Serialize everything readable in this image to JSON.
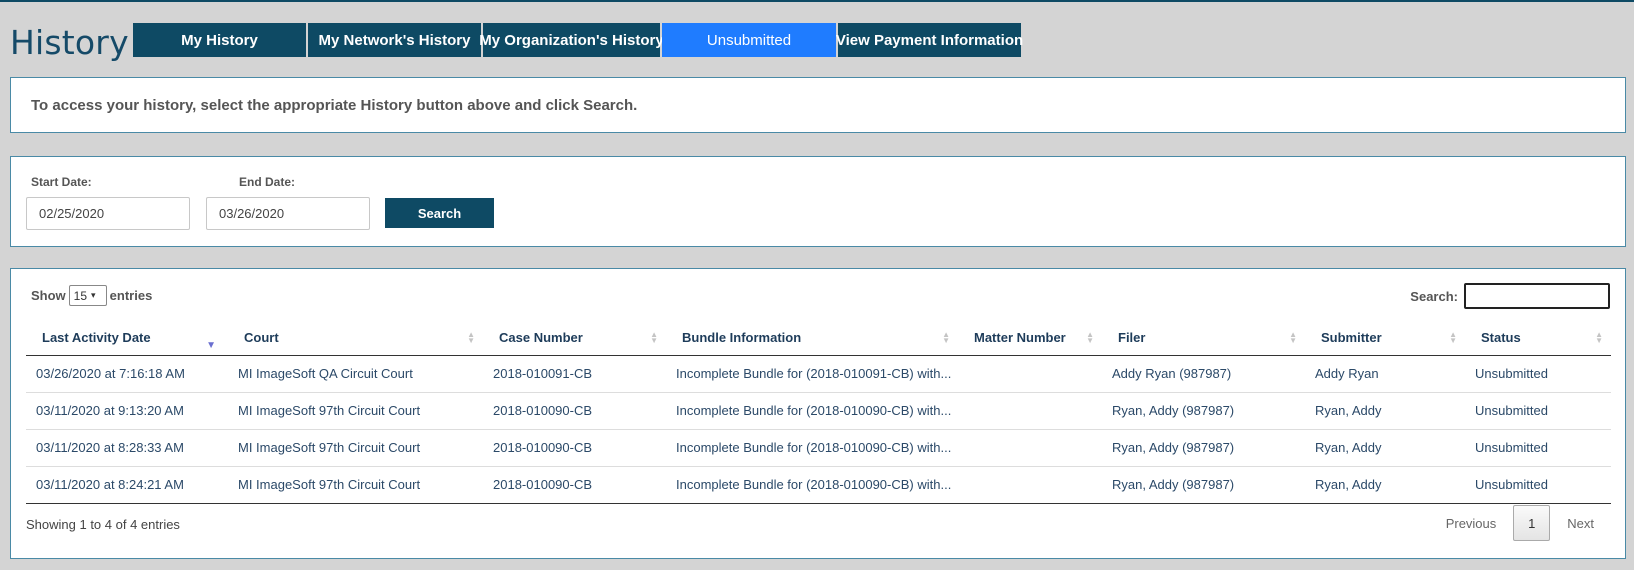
{
  "page": {
    "title": "History"
  },
  "tabs": [
    {
      "label": "My History",
      "active": false
    },
    {
      "label": "My Network's History",
      "active": false
    },
    {
      "label": "My Organization's History",
      "active": false
    },
    {
      "label": "Unsubmitted",
      "active": true
    },
    {
      "label": "View Payment Information",
      "active": false
    }
  ],
  "info": {
    "text": "To access your history, select the appropriate History button above and click Search."
  },
  "filters": {
    "start_label": "Start Date:",
    "start_value": "02/25/2020",
    "end_label": "End Date:",
    "end_value": "03/26/2020",
    "search_label": "Search"
  },
  "table": {
    "show_label": "Show",
    "entries_value": "15",
    "entries_label": "entries",
    "search_label": "Search:",
    "columns": [
      "Last Activity Date",
      "Court",
      "Case Number",
      "Bundle Information",
      "Matter Number",
      "Filer",
      "Submitter",
      "Status"
    ],
    "rows": [
      [
        "03/26/2020 at 7:16:18 AM",
        "MI ImageSoft QA Circuit Court",
        "2018-010091-CB",
        "Incomplete Bundle for (2018-010091-CB) with...",
        "",
        "Addy Ryan (987987)",
        "Addy Ryan",
        "Unsubmitted"
      ],
      [
        "03/11/2020 at 9:13:20 AM",
        "MI ImageSoft 97th Circuit Court",
        "2018-010090-CB",
        "Incomplete Bundle for (2018-010090-CB) with...",
        "",
        "Ryan, Addy (987987)",
        "Ryan, Addy",
        "Unsubmitted"
      ],
      [
        "03/11/2020 at 8:28:33 AM",
        "MI ImageSoft 97th Circuit Court",
        "2018-010090-CB",
        "Incomplete Bundle for (2018-010090-CB) with...",
        "",
        "Ryan, Addy (987987)",
        "Ryan, Addy",
        "Unsubmitted"
      ],
      [
        "03/11/2020 at 8:24:21 AM",
        "MI ImageSoft 97th Circuit Court",
        "2018-010090-CB",
        "Incomplete Bundle for (2018-010090-CB) with...",
        "",
        "Ryan, Addy (987987)",
        "Ryan, Addy",
        "Unsubmitted"
      ]
    ],
    "footer_info": "Showing 1 to 4 of 4 entries",
    "pagination": {
      "previous": "Previous",
      "current": "1",
      "next": "Next"
    }
  },
  "colors": {
    "primary": "#0e4a64",
    "active_tab": "#1f7cff",
    "background": "#d4d4d4"
  }
}
